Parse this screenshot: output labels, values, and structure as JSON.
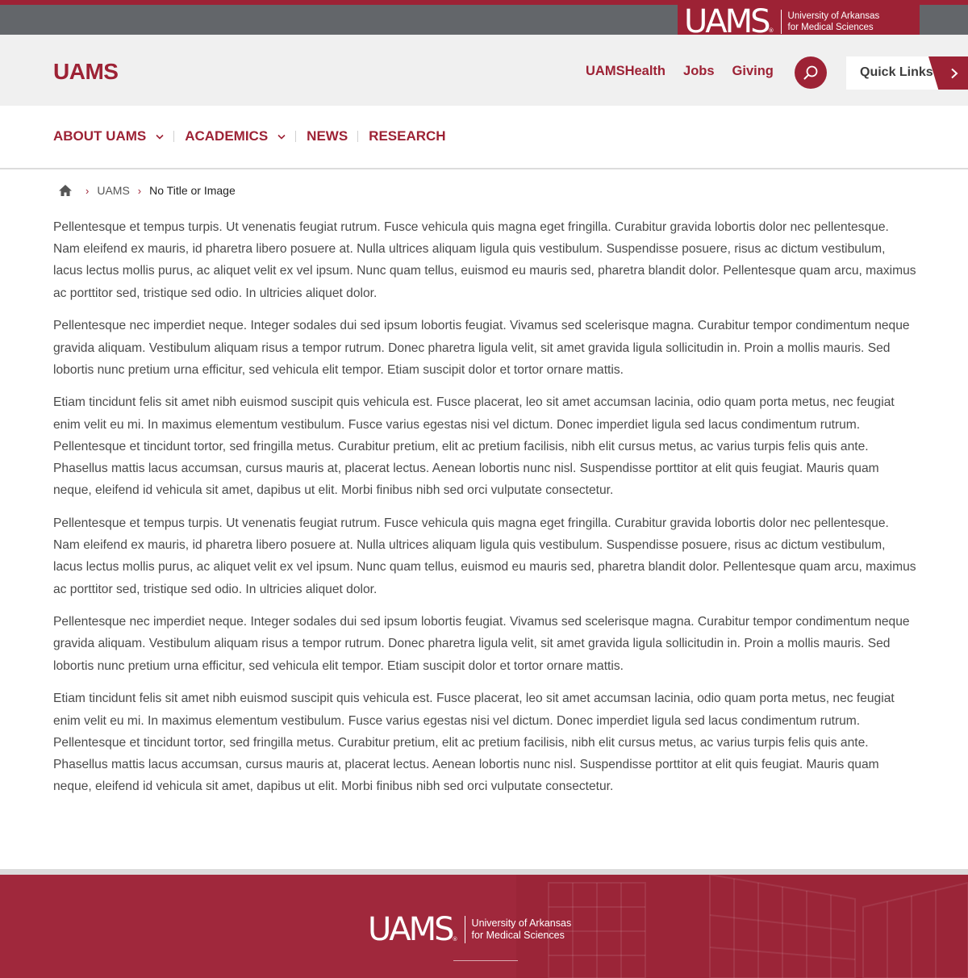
{
  "colors": {
    "brand_red": "#9d2235",
    "top_gray": "#63666a",
    "header_bg": "#f0f0f0"
  },
  "top_bar": {
    "logo": {
      "mark": "UAMS",
      "registered": "®",
      "line1": "University of Arkansas",
      "line2": "for Medical Sciences"
    }
  },
  "header": {
    "site_name": "UAMS",
    "utility_links": [
      "UAMSHealth",
      "Jobs",
      "Giving"
    ],
    "search_icon": "search-icon",
    "quick_links_label": "Quick Links",
    "quick_links_icon": "chevron-right-icon"
  },
  "nav": {
    "items": [
      {
        "label": "ABOUT UAMS",
        "has_dropdown": true
      },
      {
        "label": "ACADEMICS",
        "has_dropdown": true
      },
      {
        "label": "NEWS",
        "has_dropdown": false
      },
      {
        "label": "RESEARCH",
        "has_dropdown": false
      }
    ]
  },
  "breadcrumb": {
    "home_icon": "home-icon",
    "items": [
      "UAMS"
    ],
    "current": "No Title or Image"
  },
  "content": {
    "paragraphs": [
      "Pellentesque et tempus turpis. Ut venenatis feugiat rutrum. Fusce vehicula quis magna eget fringilla. Curabitur gravida lobortis dolor nec pellentesque. Nam eleifend ex mauris, id pharetra libero posuere at. Nulla ultrices aliquam ligula quis vestibulum. Suspendisse posuere, risus ac dictum vestibulum, lacus lectus mollis purus, ac aliquet velit ex vel ipsum. Nunc quam tellus, euismod eu mauris sed, pharetra blandit dolor. Pellentesque quam arcu, maximus ac porttitor sed, tristique sed odio. In ultricies aliquet dolor.",
      "Pellentesque nec imperdiet neque. Integer sodales dui sed ipsum lobortis feugiat. Vivamus sed scelerisque magna. Curabitur tempor condimentum neque gravida aliquam. Vestibulum aliquam risus a tempor rutrum. Donec pharetra ligula velit, sit amet gravida ligula sollicitudin in. Proin a mollis mauris. Sed lobortis nunc pretium urna efficitur, sed vehicula elit tempor. Etiam suscipit dolor et tortor ornare mattis.",
      "Etiam tincidunt felis sit amet nibh euismod suscipit quis vehicula est. Fusce placerat, leo sit amet accumsan lacinia, odio quam porta metus, nec feugiat enim velit eu mi. In maximus elementum vestibulum. Fusce varius egestas nisi vel dictum. Donec imperdiet ligula sed lacus condimentum rutrum. Pellentesque et tincidunt tortor, sed fringilla metus. Curabitur pretium, elit ac pretium facilisis, nibh elit cursus metus, ac varius turpis felis quis ante. Phasellus mattis lacus accumsan, cursus mauris at, placerat lectus. Aenean lobortis nunc nisl. Suspendisse porttitor at elit quis feugiat. Mauris quam neque, eleifend id vehicula sit amet, dapibus ut elit. Morbi finibus nibh sed orci vulputate consectetur.",
      "Pellentesque et tempus turpis. Ut venenatis feugiat rutrum. Fusce vehicula quis magna eget fringilla. Curabitur gravida lobortis dolor nec pellentesque. Nam eleifend ex mauris, id pharetra libero posuere at. Nulla ultrices aliquam ligula quis vestibulum. Suspendisse posuere, risus ac dictum vestibulum, lacus lectus mollis purus, ac aliquet velit ex vel ipsum. Nunc quam tellus, euismod eu mauris sed, pharetra blandit dolor. Pellentesque quam arcu, maximus ac porttitor sed, tristique sed odio. In ultricies aliquet dolor.",
      "Pellentesque nec imperdiet neque. Integer sodales dui sed ipsum lobortis feugiat. Vivamus sed scelerisque magna. Curabitur tempor condimentum neque gravida aliquam. Vestibulum aliquam risus a tempor rutrum. Donec pharetra ligula velit, sit amet gravida ligula sollicitudin in. Proin a mollis mauris. Sed lobortis nunc pretium urna efficitur, sed vehicula elit tempor. Etiam suscipit dolor et tortor ornare mattis.",
      "Etiam tincidunt felis sit amet nibh euismod suscipit quis vehicula est. Fusce placerat, leo sit amet accumsan lacinia, odio quam porta metus, nec feugiat enim velit eu mi. In maximus elementum vestibulum. Fusce varius egestas nisi vel dictum. Donec imperdiet ligula sed lacus condimentum rutrum. Pellentesque et tincidunt tortor, sed fringilla metus. Curabitur pretium, elit ac pretium facilisis, nibh elit cursus metus, ac varius turpis felis quis ante. Phasellus mattis lacus accumsan, cursus mauris at, placerat lectus. Aenean lobortis nunc nisl. Suspendisse porttitor at elit quis feugiat. Mauris quam neque, eleifend id vehicula sit amet, dapibus ut elit. Morbi finibus nibh sed orci vulputate consectetur."
    ]
  },
  "footer": {
    "logo": {
      "mark": "UAMS",
      "registered": "®",
      "line1": "University of Arkansas",
      "line2": "for Medical Sciences"
    }
  }
}
